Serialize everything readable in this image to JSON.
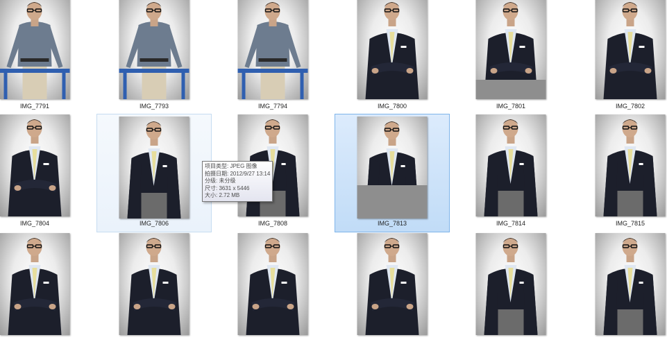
{
  "files": [
    {
      "name": "IMG_7791",
      "pose": "stand-rail",
      "state": "normal"
    },
    {
      "name": "IMG_7793",
      "pose": "stand-rail",
      "state": "normal"
    },
    {
      "name": "IMG_7794",
      "pose": "stand-rail",
      "state": "normal"
    },
    {
      "name": "IMG_7800",
      "pose": "suit-arms-crossed",
      "state": "normal"
    },
    {
      "name": "IMG_7801",
      "pose": "suit-arms-crossed",
      "state": "normal",
      "gray_bottom": true
    },
    {
      "name": "IMG_7802",
      "pose": "suit-arms-crossed",
      "state": "normal"
    },
    {
      "name": "IMG_7804",
      "pose": "suit-arms-crossed",
      "state": "normal"
    },
    {
      "name": "IMG_7806",
      "pose": "suit-hands-pockets",
      "state": "hover"
    },
    {
      "name": "IMG_7808",
      "pose": "suit-hands-pockets",
      "state": "normal"
    },
    {
      "name": "IMG_7813",
      "pose": "suit-hands-pockets",
      "state": "selected",
      "gray_bottom": true
    },
    {
      "name": "IMG_7814",
      "pose": "suit-hands-pockets",
      "state": "normal"
    },
    {
      "name": "IMG_7815",
      "pose": "suit-hands-pockets",
      "state": "normal"
    },
    {
      "name": "",
      "pose": "suit-arms-crossed",
      "state": "normal"
    },
    {
      "name": "",
      "pose": "suit-arms-crossed",
      "state": "normal"
    },
    {
      "name": "",
      "pose": "suit-arms-crossed",
      "state": "normal"
    },
    {
      "name": "",
      "pose": "suit-arms-crossed",
      "state": "normal"
    },
    {
      "name": "",
      "pose": "suit-hands-pockets",
      "state": "normal"
    },
    {
      "name": "",
      "pose": "suit-hands-pockets",
      "state": "normal"
    }
  ],
  "tooltip": {
    "type": "项目类型: JPEG 图像",
    "date_taken": "拍摄日期: 2012/9/27 13:14",
    "rating": "分级: 未分级",
    "dimensions": "尺寸: 3631 x 5446",
    "size": "大小: 2.72 MB"
  },
  "colors": {
    "hover_border": "#c6dcf1",
    "selected_border": "#7eb4ea",
    "selected_fill": "#c1dcf7"
  }
}
